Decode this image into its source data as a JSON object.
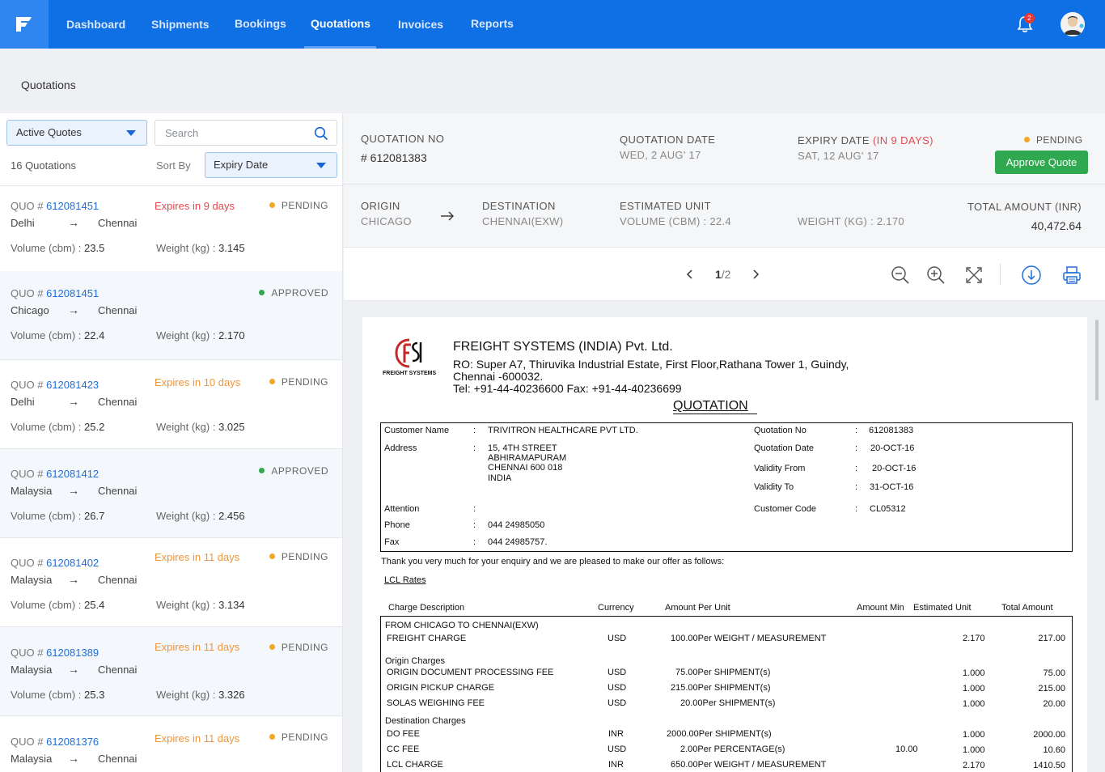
{
  "nav": {
    "items": [
      "Dashboard",
      "Shipments",
      "Bookings",
      "Quotations",
      "Invoices",
      "Reports"
    ],
    "active": "Quotations",
    "notification_count": "2"
  },
  "page": {
    "title": "Quotations"
  },
  "list": {
    "filter": "Active Quotes",
    "search_placeholder": "Search",
    "count_label": "16 Quotations",
    "sort_label": "Sort By",
    "sort_value": "Expiry Date",
    "quote_prefix": "QUO #",
    "volume_label": "Volume (cbm) :",
    "weight_label": "Weight (kg) :",
    "items": [
      {
        "no": "612081451",
        "expiry": "Expires in 9 days",
        "status": "PENDING",
        "origin": "Delhi",
        "dest": "Chennai",
        "volume": "23.5",
        "weight": "3.145"
      },
      {
        "no": "612081451",
        "expiry": "",
        "status": "APPROVED",
        "origin": "Chicago",
        "dest": "Chennai",
        "volume": "22.4",
        "weight": "2.170"
      },
      {
        "no": "612081423",
        "expiry": "Expires in 10 days",
        "status": "PENDING",
        "origin": "Delhi",
        "dest": "Chennai",
        "volume": "25.2",
        "weight": "3.025"
      },
      {
        "no": "612081412",
        "expiry": "",
        "status": "APPROVED",
        "origin": "Malaysia",
        "dest": "Chennai",
        "volume": "26.7",
        "weight": "2.456"
      },
      {
        "no": "612081402",
        "expiry": "Expires in 11 days",
        "status": "PENDING",
        "origin": "Malaysia",
        "dest": "Chennai",
        "volume": "25.4",
        "weight": "3.134"
      },
      {
        "no": "612081389",
        "expiry": "Expires in 11 days",
        "status": "PENDING",
        "origin": "Malaysia",
        "dest": "Chennai",
        "volume": "25.3",
        "weight": "3.326"
      },
      {
        "no": "612081376",
        "expiry": "Expires in 11 days",
        "status": "PENDING",
        "origin": "Malaysia",
        "dest": "Chennai",
        "volume": "",
        "weight": ""
      }
    ]
  },
  "detail": {
    "quotation_no_label": "QUOTATION NO",
    "quotation_no": "# 612081383",
    "quotation_date_label": "QUOTATION DATE",
    "quotation_date": "WED, 2 AUG' 17",
    "expiry_label": "EXPIRY DATE",
    "expiry_note": "(IN 9 DAYS)",
    "expiry_date": "SAT, 12 AUG' 17",
    "status": "PENDING",
    "approve_label": "Approve Quote",
    "origin_label": "ORIGIN",
    "origin": "CHICAGO",
    "destination_label": "DESTINATION",
    "destination": "CHENNAI(EXW)",
    "est_unit_label": "ESTIMATED UNIT",
    "volume": "VOLUME (CBM) : 22.4",
    "weight": "WEIGHT (KG) : 2.170",
    "total_label": "TOTAL AMOUNT (INR)",
    "total": "40,472.64",
    "page_current": "1",
    "page_total": "/2"
  },
  "doc": {
    "logo_text": "FREIGHT SYSTEMS",
    "company": "FREIGHT SYSTEMS (INDIA) Pvt. Ltd.",
    "addr1": "RO: Super A7, Thiruvika Industrial Estate, First Floor,Rathana Tower 1, Guindy,",
    "addr2": "Chennai -600032.",
    "addr3": "Tel: +91-44-40236600 Fax: +91-44-40236699",
    "heading": "QUOTATION",
    "customer_name_label": "Customer Name",
    "customer_name": "TRIVITRON HEALTHCARE PVT LTD.",
    "address_label": "Address",
    "address_lines": [
      "15, 4TH STREET",
      "ABHIRAMAPURAM",
      "CHENNAI 600 018",
      "INDIA"
    ],
    "attention_label": "Attention",
    "phone_label": "Phone",
    "phone": "044   24985050",
    "fax_label": "Fax",
    "fax": "044   24985757.",
    "qno_label": "Quotation No",
    "qno": "612081383",
    "qdate_label": "Quotation Date",
    "qdate": "20-OCT-16",
    "vfrom_label": "Validity From",
    "vfrom": "20-OCT-16",
    "vto_label": "Validity To",
    "vto": "31-OCT-16",
    "ccode_label": "Customer Code",
    "ccode": "CL05312",
    "colon": ":",
    "thanks": "Thank you very much for your enquiry and we are pleased to make our offer as follows:",
    "lcl": "LCL Rates",
    "cols": [
      "Charge Description",
      "Currency",
      "Amount Per Unit",
      "Amount Min",
      "Estimated Unit",
      "Total Amount"
    ],
    "route": "FROM CHICAGO TO CHENNAI(EXW)",
    "origin_charges": "Origin Charges",
    "dest_charges": "Destination Charges",
    "rows": [
      {
        "desc": "FREIGHT CHARGE",
        "cur": "USD",
        "amt": "100.00",
        "per": "Per WEIGHT / MEASUREMENT",
        "min": "",
        "unit": "2.170",
        "total": "217.00"
      },
      {
        "desc": "ORIGIN DOCUMENT PROCESSING FEE",
        "cur": "USD",
        "amt": "75.00",
        "per": "Per SHIPMENT(s)",
        "min": "",
        "unit": "1.000",
        "total": "75.00"
      },
      {
        "desc": "ORIGIN PICKUP CHARGE",
        "cur": "USD",
        "amt": "215.00",
        "per": "Per SHIPMENT(s)",
        "min": "",
        "unit": "1.000",
        "total": "215.00"
      },
      {
        "desc": "SOLAS WEIGHING FEE",
        "cur": "USD",
        "amt": "20.00",
        "per": "Per SHIPMENT(s)",
        "min": "",
        "unit": "1.000",
        "total": "20.00"
      },
      {
        "desc": "DO FEE",
        "cur": "INR",
        "amt": "2000.00",
        "per": "Per SHIPMENT(s)",
        "min": "",
        "unit": "1.000",
        "total": "2000.00"
      },
      {
        "desc": "CC FEE",
        "cur": "USD",
        "amt": "2.00",
        "per": "Per PERCENTAGE(s)",
        "min": "10.00",
        "unit": "1.000",
        "total": "10.60"
      },
      {
        "desc": "LCL CHARGE",
        "cur": "INR",
        "amt": "650.00",
        "per": "Per WEIGHT / MEASUREMENT",
        "min": "",
        "unit": "2.170",
        "total": "1410.50"
      }
    ]
  },
  "colors": {
    "brand": "#0f6fe5",
    "pending": "#f5a623",
    "approved": "#2fa84f",
    "expiry": "#e5484d",
    "orange_expiry": "#f0963a"
  }
}
